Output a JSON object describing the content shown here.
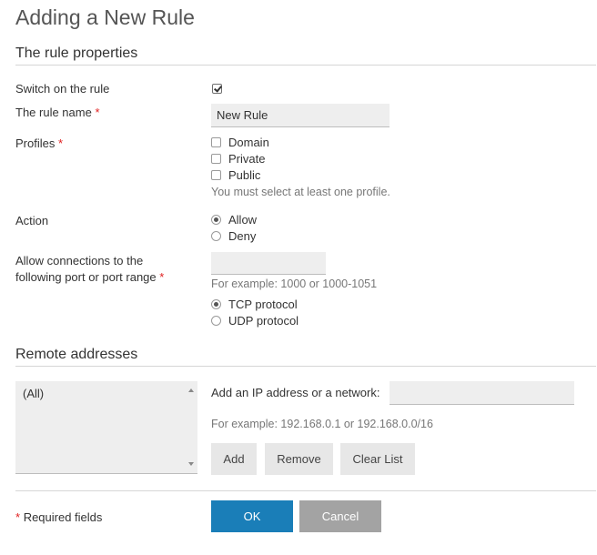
{
  "page": {
    "title": "Adding a New Rule"
  },
  "properties": {
    "heading": "The rule properties",
    "switch_label": "Switch on the rule",
    "switch_checked": true,
    "name_label": "The rule name",
    "name_value": "New Rule",
    "profiles_label": "Profiles",
    "profiles": [
      {
        "label": "Domain",
        "checked": false
      },
      {
        "label": "Private",
        "checked": false
      },
      {
        "label": "Public",
        "checked": false
      }
    ],
    "profiles_hint": "You must select at least one profile.",
    "action_label": "Action",
    "actions": [
      {
        "label": "Allow",
        "selected": true
      },
      {
        "label": "Deny",
        "selected": false
      }
    ],
    "port_label_line1": "Allow connections to the",
    "port_label_line2": "following port or port range",
    "port_value": "",
    "port_hint": "For example: 1000 or 1000-1051",
    "protocols": [
      {
        "label": "TCP protocol",
        "selected": true
      },
      {
        "label": "UDP protocol",
        "selected": false
      }
    ]
  },
  "remote": {
    "heading": "Remote addresses",
    "list_items": [
      "(All)"
    ],
    "add_label": "Add an IP address or a network:",
    "add_value": "",
    "hint": "For example: 192.168.0.1 or 192.168.0.0/16",
    "add_button": "Add",
    "remove_button": "Remove",
    "clear_button": "Clear List"
  },
  "footer": {
    "required_star": "*",
    "required_text": "Required fields",
    "ok_button": "OK",
    "cancel_button": "Cancel"
  },
  "colors": {
    "primary": "#1a7eb8",
    "required": "#e02020",
    "secondary": "#a3a3a3"
  }
}
